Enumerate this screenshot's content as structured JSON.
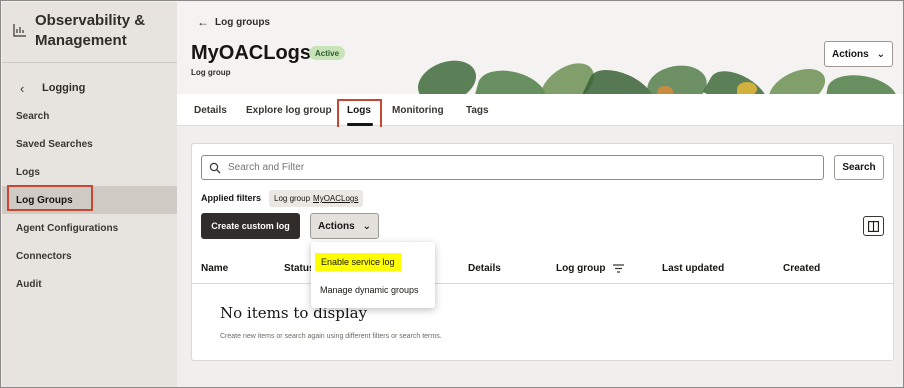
{
  "sidebar": {
    "app_title": "Observability & Management",
    "back_label": "Logging",
    "items": [
      {
        "label": "Search"
      },
      {
        "label": "Saved Searches"
      },
      {
        "label": "Logs"
      },
      {
        "label": "Log Groups",
        "active": true
      },
      {
        "label": "Agent Configurations"
      },
      {
        "label": "Connectors"
      },
      {
        "label": "Audit"
      }
    ]
  },
  "header": {
    "back_link": "Log groups",
    "title": "MyOACLogs",
    "status": "Active",
    "subtitle": "Log group",
    "actions_label": "Actions"
  },
  "tabs": [
    {
      "label": "Details"
    },
    {
      "label": "Explore log group"
    },
    {
      "label": "Logs",
      "active": true
    },
    {
      "label": "Monitoring"
    },
    {
      "label": "Tags"
    }
  ],
  "main": {
    "search_placeholder": "Search and Filter",
    "search_button": "Search",
    "applied_filters_label": "Applied filters",
    "filter_chip": {
      "key": "Log group",
      "value": "MyOACLogs"
    },
    "create_button": "Create custom log",
    "actions_button": "Actions",
    "columns": [
      "Name",
      "Status",
      "Details",
      "Log group",
      "Last updated",
      "Created"
    ],
    "empty_title": "No items to display",
    "empty_desc": "Create new items or search again using different filters or search terms."
  },
  "menu": {
    "items": [
      {
        "label": "Enable service log",
        "highlighted": true
      },
      {
        "label": "Manage dynamic groups"
      }
    ]
  },
  "colors": {
    "highlight_box": "#c74634",
    "active_badge": "#c9e3b9",
    "primary_button": "#312d2a",
    "menu_highlight": "#ffff00"
  }
}
